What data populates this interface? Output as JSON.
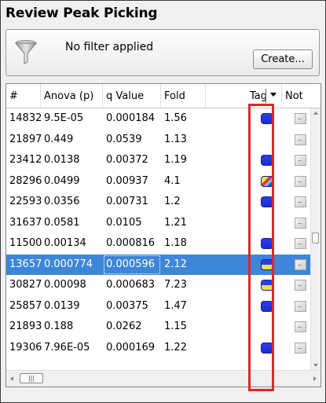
{
  "panel": {
    "title": "Review Peak Picking"
  },
  "filter": {
    "text": "No filter applied",
    "create_label": "Create..."
  },
  "columns": [
    "#",
    "Anova (p)",
    "q Value",
    "Fold",
    "Tag",
    "Not"
  ],
  "tag_colors": {
    "blue": "#2b3fe8",
    "yellow": "#f4e23a",
    "red": "#e8372c",
    "light_blue": "#6fb6f0"
  },
  "selection_color": "#3d86d9",
  "highlight_color": "#e0262a",
  "rows": [
    {
      "id": "14832",
      "anova": "9.5E-05",
      "q": "0.000184",
      "fold": "1.56",
      "tag": "blue"
    },
    {
      "id": "21897",
      "anova": "0.449",
      "q": "0.0539",
      "fold": "1.13",
      "tag": ""
    },
    {
      "id": "23412",
      "anova": "0.0138",
      "q": "0.00372",
      "fold": "1.19",
      "tag": "blue"
    },
    {
      "id": "28296",
      "anova": "0.0499",
      "q": "0.00937",
      "fold": "4.1",
      "tag": "multi"
    },
    {
      "id": "22593",
      "anova": "0.0356",
      "q": "0.00731",
      "fold": "1.2",
      "tag": "blue"
    },
    {
      "id": "31637",
      "anova": "0.0581",
      "q": "0.0105",
      "fold": "1.21",
      "tag": ""
    },
    {
      "id": "11500",
      "anova": "0.00134",
      "q": "0.000816",
      "fold": "1.18",
      "tag": "blue"
    },
    {
      "id": "13657",
      "anova": "0.000774",
      "q": "0.000596",
      "fold": "2.12",
      "tag": "blue-yellow",
      "selected": true
    },
    {
      "id": "30827",
      "anova": "0.00098",
      "q": "0.000683",
      "fold": "7.23",
      "tag": "blue-yellow"
    },
    {
      "id": "25857",
      "anova": "0.0139",
      "q": "0.00375",
      "fold": "1.47",
      "tag": "blue"
    },
    {
      "id": "21893",
      "anova": "0.188",
      "q": "0.0262",
      "fold": "1.15",
      "tag": ""
    },
    {
      "id": "19306",
      "anova": "7.96E-05",
      "q": "0.000169",
      "fold": "1.22",
      "tag": "blue"
    }
  ]
}
